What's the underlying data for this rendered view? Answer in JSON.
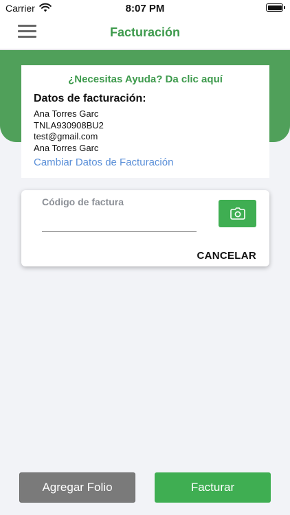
{
  "status_bar": {
    "carrier": "Carrier",
    "time": "8:07 PM"
  },
  "nav": {
    "title": "Facturación"
  },
  "billing_card": {
    "help_link": "¿Necesitas Ayuda? Da clic aquí",
    "heading": "Datos de facturación:",
    "name": "Ana Torres Garc",
    "rfc": "TNLA930908BU2",
    "email": "test@gmail.com",
    "business_name": "Ana Torres Garc",
    "change_link": "Cambiar Datos de Facturación"
  },
  "code_card": {
    "label": "Código de factura",
    "input_value": "",
    "cancel_label": "CANCELAR"
  },
  "actions": {
    "add_folio_label": "Agregar Folio",
    "invoice_label": "Facturar"
  },
  "colors": {
    "brand_green": "#3d9a4c",
    "band_green": "#50a05a",
    "button_green": "#3fae52",
    "link_blue": "#5a8fd8",
    "secondary_gray": "#7a7a7a"
  },
  "icons": {
    "menu": "hamburger-icon",
    "camera": "camera-icon",
    "wifi": "wifi-icon",
    "battery": "battery-icon"
  }
}
